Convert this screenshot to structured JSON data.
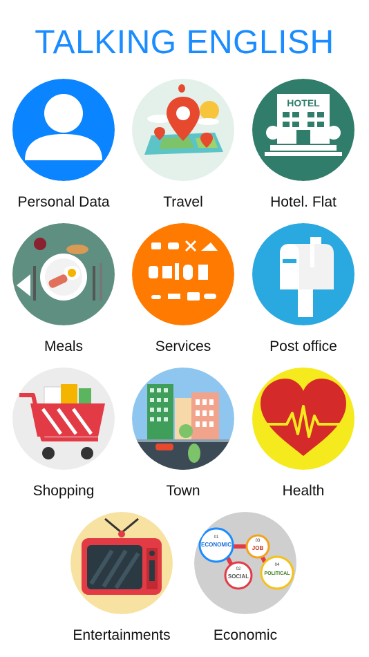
{
  "title": "TALKING ENGLISH",
  "topics": [
    {
      "label": "Personal Data",
      "icon": "person-icon"
    },
    {
      "label": "Travel",
      "icon": "map-pin-icon"
    },
    {
      "label": "Hotel. Flat",
      "icon": "hotel-icon"
    },
    {
      "label": "Meals",
      "icon": "plate-icon"
    },
    {
      "label": "Services",
      "icon": "services-icon"
    },
    {
      "label": "Post office",
      "icon": "mailbox-icon"
    },
    {
      "label": "Shopping",
      "icon": "cart-icon"
    },
    {
      "label": "Town",
      "icon": "city-icon"
    },
    {
      "label": "Health",
      "icon": "heart-icon"
    },
    {
      "label": "Entertainments",
      "icon": "tv-icon"
    },
    {
      "label": "Economic",
      "icon": "economic-icon"
    }
  ],
  "hotel_sign": "HOTEL",
  "economic_bubbles": [
    {
      "num": "01",
      "word": "ECONOMIC"
    },
    {
      "num": "02",
      "word": "SOCIAL"
    },
    {
      "num": "03",
      "word": "JOB"
    },
    {
      "num": "04",
      "word": "POLITICAL"
    }
  ],
  "colors": {
    "title": "#1a8cff",
    "personal": "#0a84ff",
    "services": "#ff7a00",
    "post": "#2aa8e0",
    "hotel": "#2f7d6a"
  }
}
